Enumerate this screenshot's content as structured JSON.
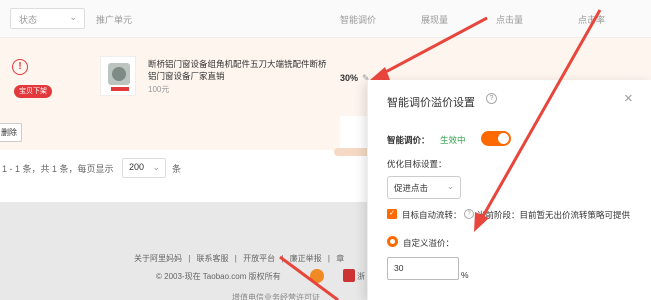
{
  "table": {
    "status_placeholder": "状态",
    "columns": [
      "推广单元",
      "智能调价",
      "展现量",
      "点击量",
      "点击率"
    ]
  },
  "row": {
    "badge": "宝贝下架",
    "title": "断桥铝门窗设备组角机配件五刀大端铣配件断桥铝门窗设备厂家直销",
    "price": "100元",
    "premium_pct": "30%"
  },
  "bulk": {
    "delete_label": "删除"
  },
  "pager": {
    "summary": "1 - 1 条，共 1 条，每页显示",
    "page_size": "200",
    "unit": "条"
  },
  "footer": {
    "links": [
      "关于阿里妈妈",
      "|",
      "联系客服",
      "|",
      "开放平台",
      "|",
      "廉正举报",
      "|",
      "章"
    ],
    "copyright": "© 2003-现在 Taobao.com 版权所有",
    "badge_text": "浙",
    "bottom": "增值电信业务经营许可证"
  },
  "modal": {
    "title": "智能调价溢价设置",
    "smart_label": "智能调价：",
    "smart_status": "生效中",
    "target_label": "优化目标设置：",
    "target_value": "促进点击",
    "auto_label": "目标自动流转：",
    "auto_desc": "当前阶段：目前暂无出价流转策略可提供",
    "custom_label": "自定义溢价：",
    "premium_value": "30",
    "premium_unit": "%"
  },
  "colors": {
    "accent": "#ff6a00",
    "danger": "#e4393c",
    "success": "#2ea14a"
  }
}
